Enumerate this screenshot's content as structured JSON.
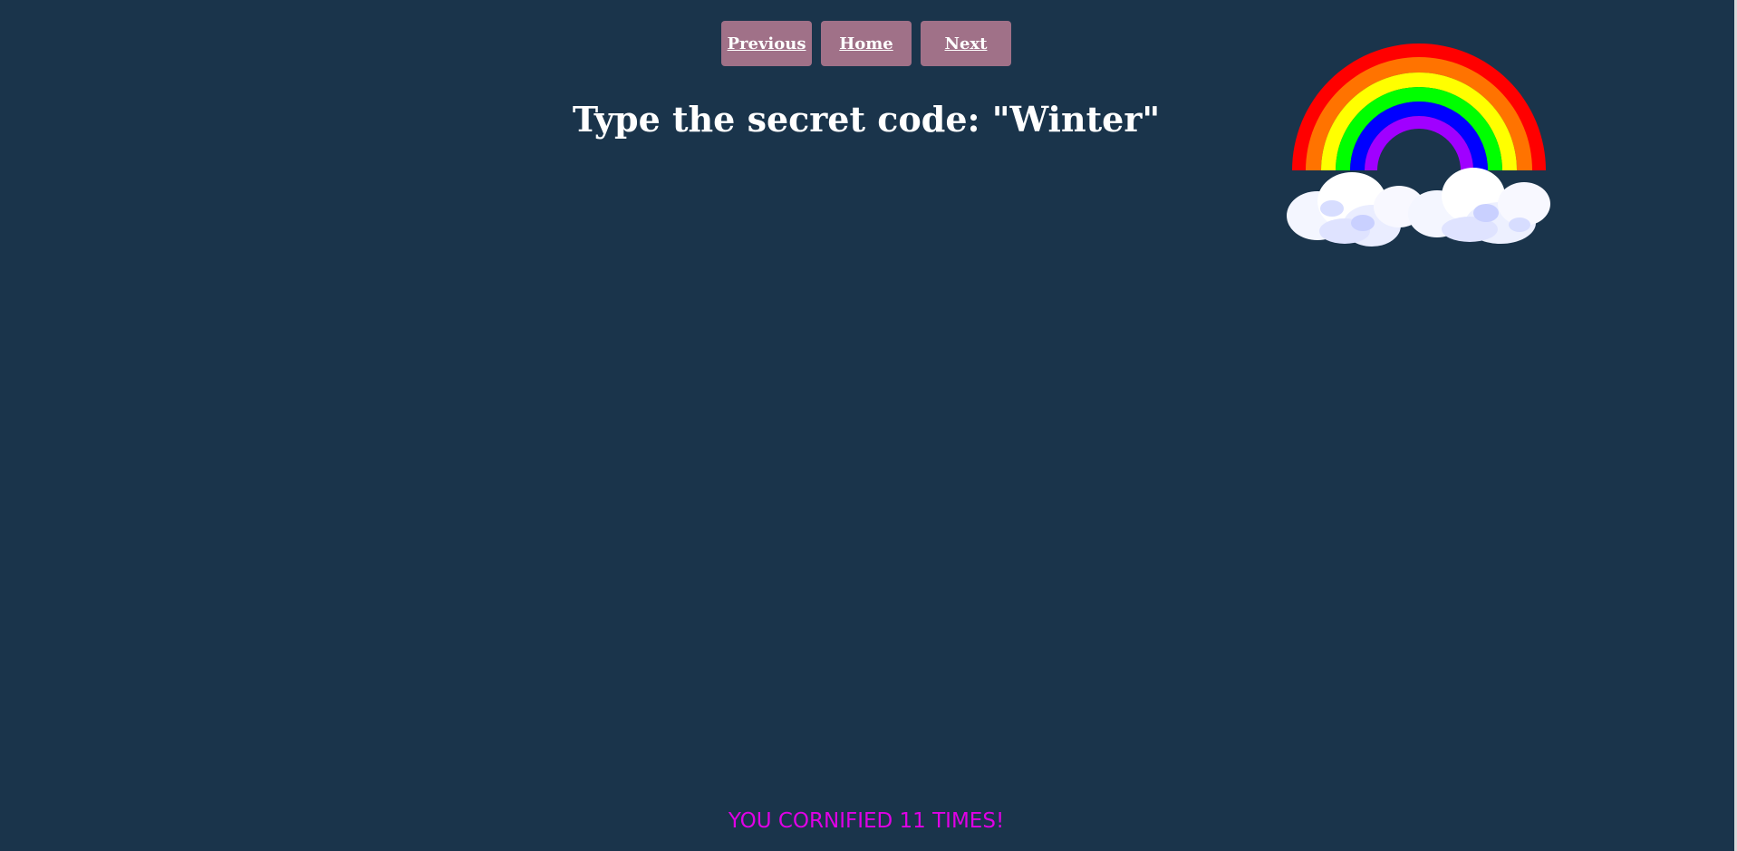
{
  "nav": {
    "previous_label": "Previous",
    "home_label": "Home",
    "next_label": "Next"
  },
  "main": {
    "title": "Type the secret code: \"Winter\""
  },
  "footer": {
    "counter_text": "YOU CORNIFIED 11 TIMES!"
  },
  "decoration": {
    "image": "rainbow-with-clouds-icon"
  },
  "colors": {
    "background": "#1a344b",
    "button": "#a07188",
    "counter_text": "#e000e6"
  }
}
